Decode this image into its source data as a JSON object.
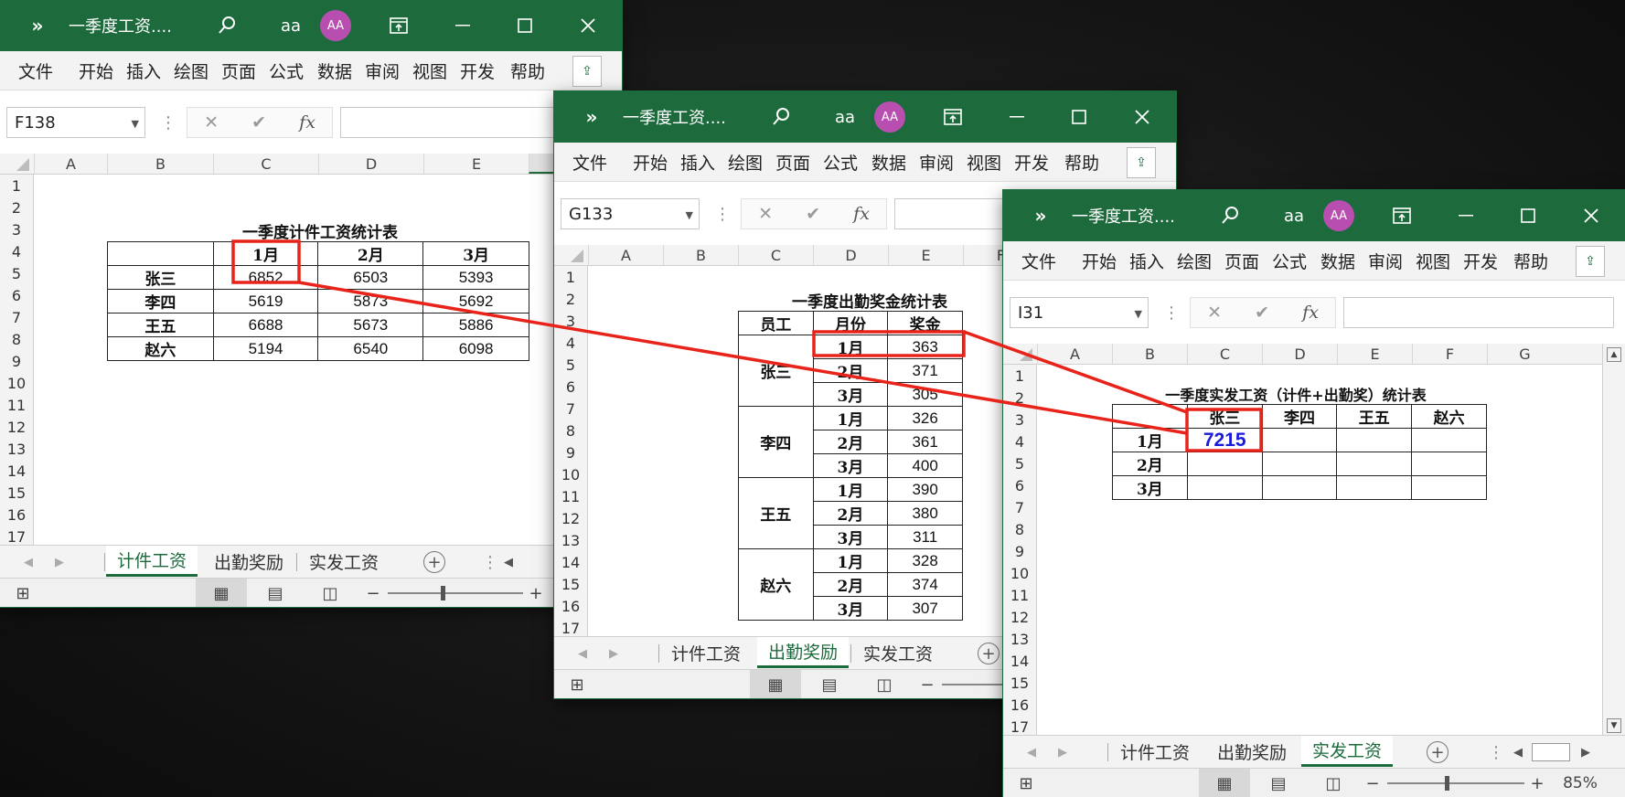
{
  "app": {
    "window_title": "一季度工资....",
    "expand_label": "»",
    "user_initials": "aa",
    "avatar_initials": "AA",
    "menu": [
      "文件",
      "开始",
      "插入",
      "绘图",
      "页面",
      "公式",
      "数据",
      "审阅",
      "视图",
      "开发",
      "帮助"
    ],
    "sheet_tabs": [
      "计件工资",
      "出勤奖励",
      "实发工资"
    ]
  },
  "window1": {
    "name_box": "F138",
    "col_headers": [
      "A",
      "B",
      "C",
      "D",
      "E"
    ],
    "row_numbers": [
      "1",
      "2",
      "3",
      "4",
      "5",
      "6",
      "7",
      "8",
      "9",
      "10",
      "11",
      "12",
      "13",
      "14",
      "15",
      "16",
      "17"
    ],
    "table_title": "一季度计件工资统计表",
    "table_header": [
      "",
      "1月",
      "2月",
      "3月"
    ],
    "table_rows": [
      [
        "张三",
        "6852",
        "6503",
        "5393"
      ],
      [
        "李四",
        "5619",
        "5873",
        "5692"
      ],
      [
        "王五",
        "6688",
        "5673",
        "5886"
      ],
      [
        "赵六",
        "5194",
        "6540",
        "6098"
      ]
    ],
    "active_tab": "计件工资"
  },
  "window2": {
    "name_box": "G133",
    "col_headers": [
      "A",
      "B",
      "C",
      "D",
      "E",
      "F"
    ],
    "row_numbers": [
      "1",
      "2",
      "3",
      "4",
      "5",
      "6",
      "7",
      "8",
      "9",
      "10",
      "11",
      "12",
      "13",
      "14",
      "15",
      "16",
      "17"
    ],
    "table_title": "一季度出勤奖金统计表",
    "table_header": [
      "员工",
      "月份",
      "奖金"
    ],
    "groups": [
      {
        "name": "张三",
        "rows": [
          [
            "1月",
            "363"
          ],
          [
            "2月",
            "371"
          ],
          [
            "3月",
            "305"
          ]
        ]
      },
      {
        "name": "李四",
        "rows": [
          [
            "1月",
            "326"
          ],
          [
            "2月",
            "361"
          ],
          [
            "3月",
            "400"
          ]
        ]
      },
      {
        "name": "王五",
        "rows": [
          [
            "1月",
            "390"
          ],
          [
            "2月",
            "380"
          ],
          [
            "3月",
            "311"
          ]
        ]
      },
      {
        "name": "赵六",
        "rows": [
          [
            "1月",
            "328"
          ],
          [
            "2月",
            "374"
          ],
          [
            "3月",
            "307"
          ]
        ]
      }
    ],
    "active_tab": "出勤奖励"
  },
  "window3": {
    "name_box": "I31",
    "col_headers": [
      "A",
      "B",
      "C",
      "D",
      "E",
      "F",
      "G"
    ],
    "row_numbers": [
      "1",
      "2",
      "3",
      "4",
      "5",
      "6",
      "7",
      "8",
      "9",
      "10",
      "11",
      "12",
      "13",
      "14",
      "15",
      "16",
      "17"
    ],
    "table_title": "一季度实发工资（计件+出勤奖）统计表",
    "table_header": [
      "",
      "张三",
      "李四",
      "王五",
      "赵六"
    ],
    "table_rows": [
      [
        "1月",
        "7215",
        "",
        "",
        ""
      ],
      [
        "2月",
        "",
        "",
        "",
        ""
      ],
      [
        "3月",
        "",
        "",
        "",
        ""
      ]
    ],
    "active_tab": "实发工资",
    "zoom": "85%"
  },
  "colors": {
    "excel_green": "#1d6b3c",
    "highlight_red": "#e8231a",
    "result_blue": "#1a1adf",
    "avatar": "#b84fb0"
  }
}
